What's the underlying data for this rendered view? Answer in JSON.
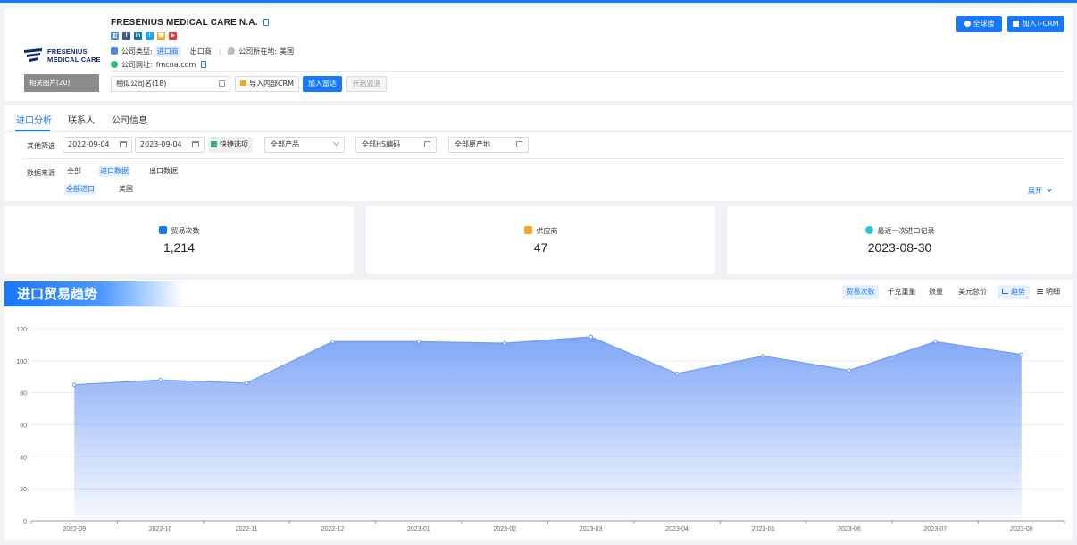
{
  "company": {
    "name": "FRESENIUS MEDICAL CARE N.A.",
    "logo_text_line1": "FRESENIUS",
    "logo_text_line2": "MEDICAL CARE",
    "related_images": "相关图片(20)",
    "type_label": "公司类型:",
    "type_importer": "进口商",
    "type_exporter": "出口商",
    "location_label": "公司所在地:",
    "location": "美国",
    "website_label": "公司网址:",
    "website": "fmcna.com",
    "similar": "相似公司名(18)",
    "btn_import_crm": "导入内部CRM",
    "btn_radar": "加入雷达",
    "btn_monitor": "开启监测",
    "btn_global_search": "全球搜",
    "btn_add_tcrm": "加入T-CRM",
    "socials": [
      {
        "icon": "website-icon",
        "color": "#4a90d9",
        "glyph": "◧"
      },
      {
        "icon": "facebook-icon",
        "color": "#3b5998",
        "glyph": "f"
      },
      {
        "icon": "linkedin-icon",
        "color": "#0e76a8",
        "glyph": "in"
      },
      {
        "icon": "twitter-icon",
        "color": "#1da1f2",
        "glyph": "t"
      },
      {
        "icon": "phone-icon",
        "color": "#f5a623",
        "glyph": "☎"
      },
      {
        "icon": "youtube-icon",
        "color": "#e53935",
        "glyph": "▶"
      }
    ]
  },
  "tabs": [
    {
      "label": "进口分析",
      "active": true
    },
    {
      "label": "联系人",
      "active": false
    },
    {
      "label": "公司信息",
      "active": false
    }
  ],
  "filters": {
    "label": "其他筛选",
    "date_from": "2022-09-04",
    "date_to": "2023-09-04",
    "quick": "快捷选项",
    "product": "全部产品",
    "hs_code": "全部HS编码",
    "origin": "全部原产地",
    "source_label": "数据来源",
    "source_all": "全部",
    "source_import": "进口数据",
    "source_export": "出口数据",
    "sub_all_import": "全部进口",
    "sub_usa": "美国",
    "expand": "展开"
  },
  "stats": [
    {
      "label": "贸易次数",
      "value": "1,214",
      "icon": "bar-chart-icon",
      "color": "#1677ff"
    },
    {
      "label": "供应商",
      "value": "47",
      "icon": "supplier-icon",
      "color": "#f5a623"
    },
    {
      "label": "最近一次进口记录",
      "value": "2023-08-30",
      "icon": "clock-icon",
      "color": "#26c6da"
    }
  ],
  "chart_controls": {
    "trade_count": "贸易次数",
    "weight": "千克重量",
    "quantity": "数量",
    "usd_total": "美元总价",
    "trend": "趋势",
    "detail": "明细"
  },
  "chart_data": {
    "type": "area",
    "title": "进口贸易趋势",
    "categories": [
      "2022-09",
      "2022-10",
      "2022-11",
      "2022-12",
      "2023-01",
      "2023-02",
      "2023-03",
      "2023-04",
      "2023-05",
      "2023-06",
      "2023-07",
      "2023-08"
    ],
    "values": [
      85,
      88,
      86,
      112,
      112,
      111,
      115,
      92,
      103,
      94,
      112,
      104
    ],
    "ylim": [
      0,
      120
    ],
    "yticks": [
      0,
      20,
      40,
      60,
      80,
      100,
      120
    ],
    "grid": true,
    "color": "#6e9bf5"
  }
}
